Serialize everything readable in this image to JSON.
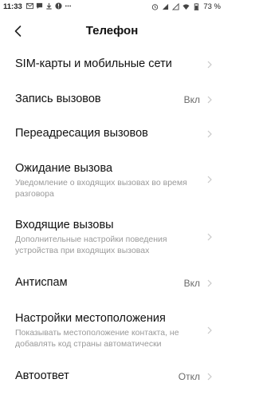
{
  "status": {
    "time": "11:33",
    "battery": "73 %"
  },
  "header": {
    "title": "Телефон"
  },
  "items": [
    {
      "title": "SIM-карты и мобильные сети",
      "subtitle": "",
      "value": ""
    },
    {
      "title": "Запись вызовов",
      "subtitle": "",
      "value": "Вкл"
    },
    {
      "title": "Переадресация вызовов",
      "subtitle": "",
      "value": ""
    },
    {
      "title": "Ожидание вызова",
      "subtitle": "Уведомление о входящих вызовах во время разговора",
      "value": ""
    },
    {
      "title": "Входящие вызовы",
      "subtitle": "Дополнительные настройки поведения устройства при входящих вызовах",
      "value": ""
    },
    {
      "title": "Антиспам",
      "subtitle": "",
      "value": "Вкл"
    },
    {
      "title": "Настройки местоположения",
      "subtitle": "Показывать местоположение контакта, не добавлять код страны автоматически",
      "value": ""
    },
    {
      "title": "Автоответ",
      "subtitle": "",
      "value": "Откл"
    }
  ]
}
